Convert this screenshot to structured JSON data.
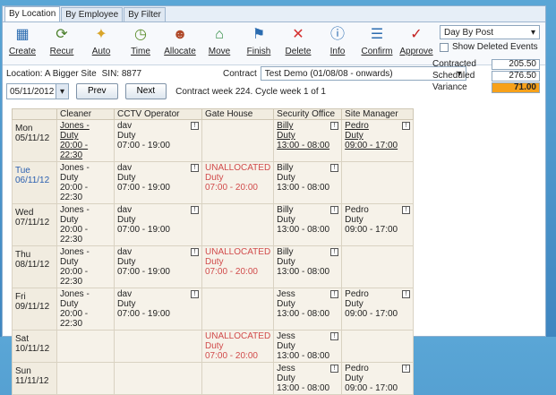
{
  "tabs": [
    {
      "label": "By Location"
    },
    {
      "label": "By Employee"
    },
    {
      "label": "By Filter"
    }
  ],
  "toolbar": [
    {
      "icon": "calendar-create",
      "label": "Create"
    },
    {
      "icon": "recur",
      "label": "Recur"
    },
    {
      "icon": "wand",
      "label": "Auto"
    },
    {
      "icon": "clock",
      "label": "Time"
    },
    {
      "icon": "person",
      "label": "Allocate"
    },
    {
      "icon": "move",
      "label": "Move"
    },
    {
      "icon": "finish",
      "label": "Finish"
    },
    {
      "icon": "delete-x",
      "label": "Delete"
    },
    {
      "icon": "info",
      "label": "Info"
    },
    {
      "icon": "confirm",
      "label": "Confirm"
    },
    {
      "icon": "approve",
      "label": "Approve"
    }
  ],
  "view": {
    "mode": "Day By Post",
    "show_deleted": "Show Deleted Events"
  },
  "location": {
    "label": "Location: A Bigger Site",
    "sin": "SIN: 8877"
  },
  "contract": {
    "label": "Contract",
    "value": "Test Demo (01/08/08 - onwards)"
  },
  "summary": {
    "contracted_label": "Contracted",
    "contracted": "205.50",
    "scheduled_label": "Scheduled",
    "scheduled": "276.50",
    "variance_label": "Variance",
    "variance": "71.00"
  },
  "date": {
    "value": "05/11/2012",
    "prev": "Prev",
    "next": "Next",
    "week_text": "Contract week 224. Cycle week 1 of 1"
  },
  "headers": [
    "Cleaner",
    "CCTV Operator",
    "Gate House",
    "Security Office",
    "Site Manager"
  ],
  "rows": [
    {
      "day": "Mon",
      "date": "05/11/12",
      "color": "#222",
      "cells": [
        {
          "l1": "Jones -",
          "l2": "Duty",
          "l3": "20:00 - 22:30",
          "ul": true
        },
        {
          "l1": "dav",
          "l2": "Duty",
          "l3": "07:00 - 19:00",
          "warn": true
        },
        {},
        {
          "l1": "Billy",
          "l2": "Duty",
          "l3": "13:00 - 08:00",
          "warn": true,
          "ul": true
        },
        {
          "l1": "Pedro",
          "l2": "Duty",
          "l3": "09:00 - 17:00",
          "warn": true,
          "ul": true
        }
      ]
    },
    {
      "day": "Tue",
      "date": "06/11/12",
      "color": "#2a5fb0",
      "cells": [
        {
          "l1": "Jones -",
          "l2": "Duty",
          "l3": "20:00 - 22:30"
        },
        {
          "l1": "dav",
          "l2": "Duty",
          "l3": "07:00 - 19:00",
          "warn": true
        },
        {
          "l1": "UNALLOCATED",
          "l2": "Duty",
          "l3": "07:00 - 20:00",
          "red": true
        },
        {
          "l1": "Billy",
          "l2": "Duty",
          "l3": "13:00 - 08:00",
          "warn": true
        },
        {}
      ]
    },
    {
      "day": "Wed",
      "date": "07/11/12",
      "color": "#222",
      "cells": [
        {
          "l1": "Jones -",
          "l2": "Duty",
          "l3": "20:00 - 22:30"
        },
        {
          "l1": "dav",
          "l2": "Duty",
          "l3": "07:00 - 19:00",
          "warn": true
        },
        {},
        {
          "l1": "Billy",
          "l2": "Duty",
          "l3": "13:00 - 08:00",
          "warn": true
        },
        {
          "l1": "Pedro",
          "l2": "Duty",
          "l3": "09:00 - 17:00",
          "warn": true
        }
      ]
    },
    {
      "day": "Thu",
      "date": "08/11/12",
      "color": "#222",
      "cells": [
        {
          "l1": "Jones -",
          "l2": "Duty",
          "l3": "20:00 - 22:30"
        },
        {
          "l1": "dav",
          "l2": "Duty",
          "l3": "07:00 - 19:00",
          "warn": true
        },
        {
          "l1": "UNALLOCATED",
          "l2": "Duty",
          "l3": "07:00 - 20:00",
          "red": true
        },
        {
          "l1": "Billy",
          "l2": "Duty",
          "l3": "13:00 - 08:00",
          "warn": true
        },
        {}
      ]
    },
    {
      "day": "Fri",
      "date": "09/11/12",
      "color": "#222",
      "cells": [
        {
          "l1": "Jones -",
          "l2": "Duty",
          "l3": "20:00 - 22:30"
        },
        {
          "l1": "dav",
          "l2": "Duty",
          "l3": "07:00 - 19:00",
          "warn": true
        },
        {},
        {
          "l1": "Jess",
          "l2": "Duty",
          "l3": "13:00 - 08:00",
          "warn": true
        },
        {
          "l1": "Pedro",
          "l2": "Duty",
          "l3": "09:00 - 17:00",
          "warn": true
        }
      ]
    },
    {
      "day": "Sat",
      "date": "10/11/12",
      "color": "#222",
      "cells": [
        {},
        {},
        {
          "l1": "UNALLOCATED",
          "l2": "Duty",
          "l3": "07:00 - 20:00",
          "red": true
        },
        {
          "l1": "Jess",
          "l2": "Duty",
          "l3": "13:00 - 08:00",
          "warn": true
        },
        {}
      ]
    },
    {
      "day": "Sun",
      "date": "11/11/12",
      "color": "#222",
      "cells": [
        {},
        {},
        {},
        {
          "l1": "Jess",
          "l2": "Duty",
          "l3": "13:00 - 08:00",
          "warn": true
        },
        {
          "l1": "Pedro",
          "l2": "Duty",
          "l3": "09:00 - 17:00",
          "warn": true
        }
      ]
    }
  ]
}
